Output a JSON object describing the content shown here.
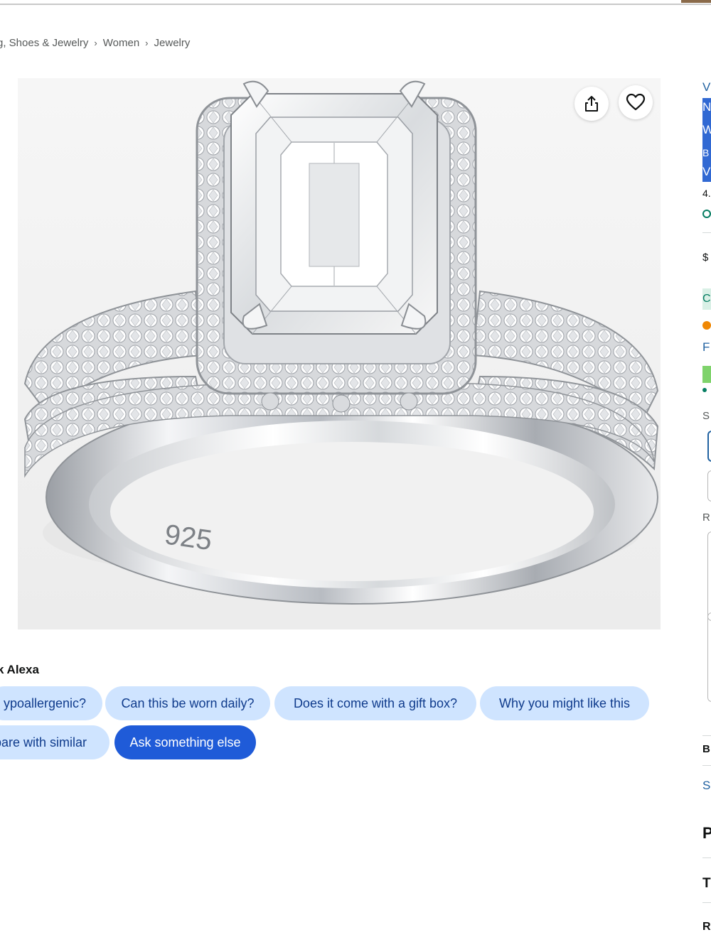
{
  "breadcrumb": {
    "items": [
      "g, Shoes & Jewelry",
      "Women",
      "Jewelry"
    ],
    "separator": "›"
  },
  "product_image": {
    "engraving": "925",
    "icons": [
      "share-icon",
      "heart-icon"
    ]
  },
  "ask_alexa": {
    "title": "k Alexa",
    "chips": [
      "ypoallergenic?",
      "Can this be worn daily?",
      "Does it come with a gift box?",
      "Why you might like this",
      "pare with similar",
      "Ask something else"
    ]
  },
  "right_column": {
    "fragments": [
      "V",
      "N",
      "W",
      "B",
      "V",
      "4.",
      "$",
      "C",
      "F",
      "S",
      "R",
      "B",
      "S",
      "P",
      "T",
      "R"
    ]
  },
  "colors": {
    "chip_background": "#cfe4ff",
    "chip_text": "#0f3b8c",
    "chip_primary": "#1f5bd8",
    "link": "#2162a1",
    "selection": "#3169d3"
  }
}
